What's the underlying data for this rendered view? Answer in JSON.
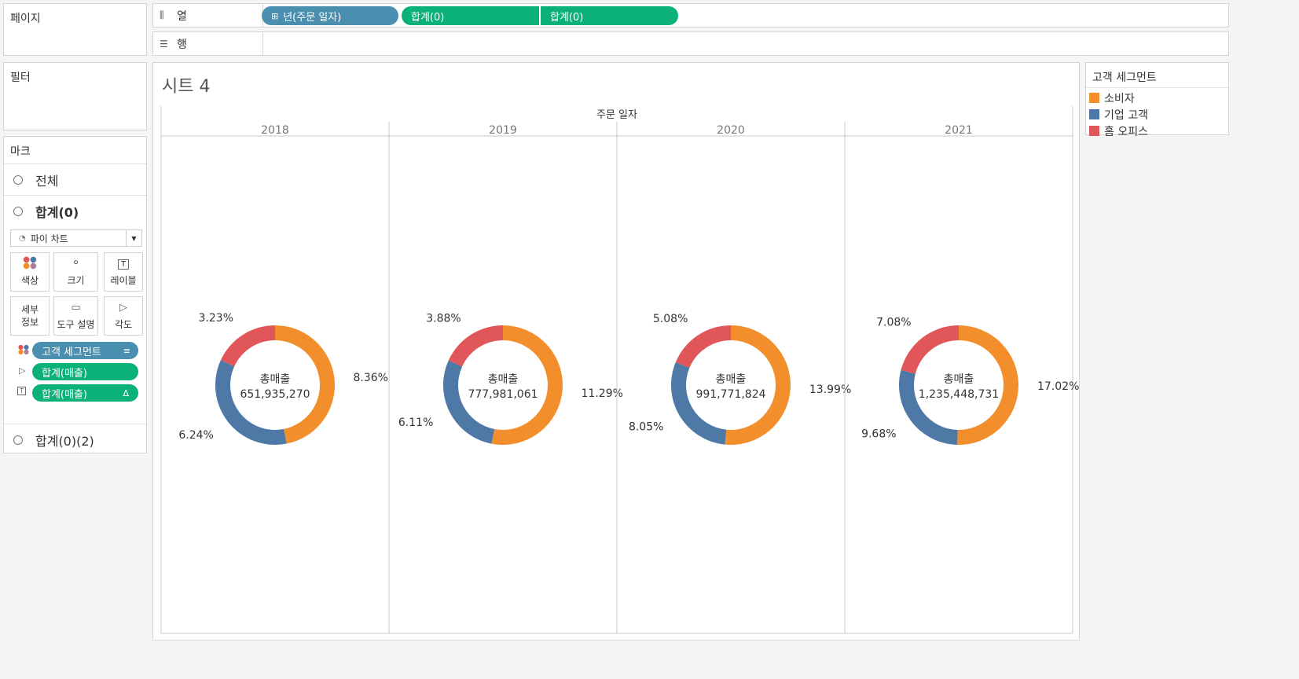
{
  "shelves": {
    "pages_label": "페이지",
    "columns_label": "열",
    "rows_label": "행",
    "filters_label": "필터",
    "column_pills": [
      "년(주문 일자)",
      "합계(0)",
      "합계(0)"
    ]
  },
  "marks": {
    "title": "마크",
    "rows": [
      "전체",
      "합계(0)",
      "합계(0)(2)"
    ],
    "mark_type": "파이 차트",
    "cards": [
      "색상",
      "크기",
      "레이블",
      "세부\n정보",
      "도구 설명",
      "각도"
    ],
    "pills": [
      "고객 세그먼트",
      "합계(매출)",
      "합계(매출)"
    ]
  },
  "sheet_title": "시트 4",
  "legend": {
    "title": "고객 세그먼트",
    "items": [
      {
        "label": "소비자",
        "color": "#f28e2b"
      },
      {
        "label": "기업 고객",
        "color": "#4e79a7"
      },
      {
        "label": "홈 오피스",
        "color": "#e15759"
      }
    ]
  },
  "chart_data": {
    "type": "pie",
    "header": "주문 일자",
    "categories": [
      "2018",
      "2019",
      "2020",
      "2021"
    ],
    "center_title": "총매출",
    "center_values": [
      "651,935,270",
      "777,981,061",
      "991,771,824",
      "1,235,448,731"
    ],
    "series": [
      {
        "name": "소비자",
        "color": "#f28e2b",
        "values": [
          8.36,
          11.29,
          13.99,
          17.02
        ],
        "labels": [
          "8.36%",
          "11.29%",
          "13.99%",
          "17.02%"
        ]
      },
      {
        "name": "기업 고객",
        "color": "#4e79a7",
        "values": [
          6.24,
          6.11,
          8.05,
          9.68
        ],
        "labels": [
          "6.24%",
          "6.11%",
          "8.05%",
          "9.68%"
        ]
      },
      {
        "name": "홈 오피스",
        "color": "#e15759",
        "values": [
          3.23,
          3.88,
          5.08,
          7.08
        ],
        "labels": [
          "3.23%",
          "3.88%",
          "5.08%",
          "7.08%"
        ]
      }
    ]
  }
}
